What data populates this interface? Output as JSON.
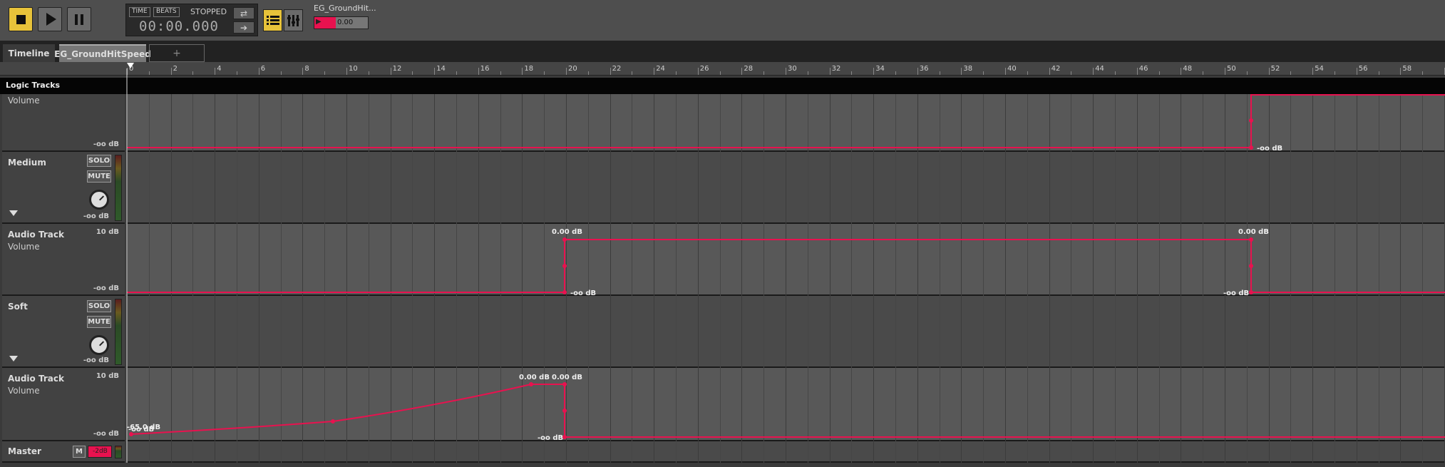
{
  "toolbar": {
    "mode_time": "TIME",
    "mode_beats": "BEATS",
    "status": "STOPPED",
    "time": "00:00.000",
    "project_name": "EG_GroundHit...",
    "project_value": "0.00"
  },
  "tabs": [
    {
      "label": "Timeline"
    },
    {
      "label": "EG_GroundHitSpeed"
    },
    {
      "label": "+"
    }
  ],
  "ruler": {
    "ticks": [
      "0",
      "2",
      "4",
      "6",
      "8",
      "10",
      "12",
      "14",
      "16",
      "18",
      "20",
      "22",
      "24",
      "26",
      "28",
      "30",
      "32",
      "34",
      "36",
      "38",
      "40",
      "42",
      "44",
      "46",
      "48",
      "50",
      "52",
      "54",
      "56",
      "58"
    ]
  },
  "logic_tracks_label": "Logic Tracks",
  "tracks": {
    "vol_top": {
      "sub": "Volume",
      "bottom": "-oo dB",
      "point_label": "-oo dB"
    },
    "medium": {
      "name": "Medium",
      "solo": "SOLO",
      "mute": "MUTE",
      "level": "-oo dB"
    },
    "audio1": {
      "name": "Audio Track",
      "sub": "Volume",
      "top": "10 dB",
      "bottom": "-oo dB",
      "labels": [
        "0.00 dB",
        "-oo dB",
        "0.00 dB",
        "-oo dB"
      ]
    },
    "soft": {
      "name": "Soft",
      "solo": "SOLO",
      "mute": "MUTE",
      "level": "-oo dB"
    },
    "audio2": {
      "name": "Audio Track",
      "sub": "Volume",
      "top": "10 dB",
      "bottom": "-oo dB",
      "labels": [
        "-65.0 dB",
        "-oo dB",
        "0.00 dB",
        "0.00 dB",
        "-oo dB"
      ]
    },
    "master": {
      "name": "Master",
      "m": "M",
      "level": "-2dB"
    }
  },
  "colors": {
    "accent": "#e8c33a",
    "automation": "#e8124f"
  }
}
